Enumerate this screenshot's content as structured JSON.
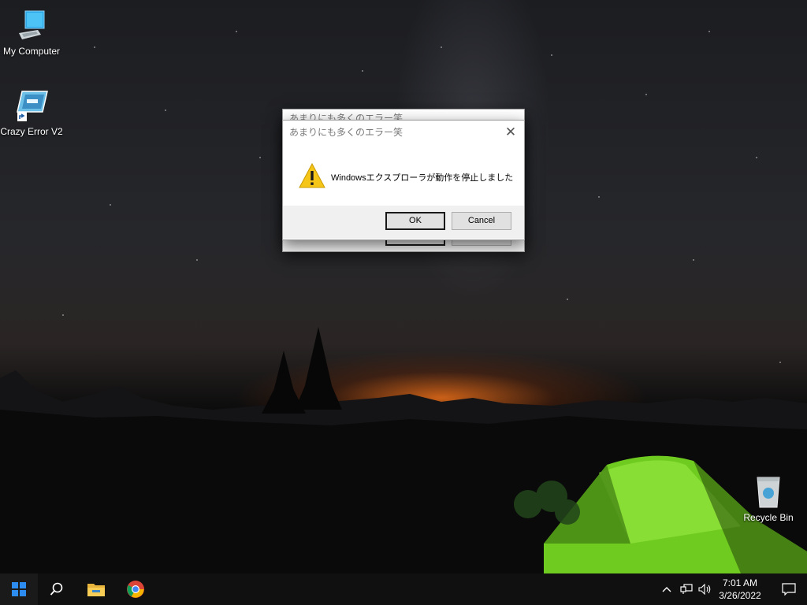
{
  "desktop": {
    "icons": [
      {
        "label": "My Computer",
        "icon": "computer-icon"
      },
      {
        "label": "Crazy Error V2",
        "icon": "app-shortcut-icon"
      },
      {
        "label": "Recycle Bin",
        "icon": "recycle-bin-icon"
      }
    ]
  },
  "dialog_back": {
    "title": "あまりにも多くのエラー笑"
  },
  "dialog": {
    "title": "あまりにも多くのエラー笑",
    "message": "Windowsエクスプローラが動作を停止しました",
    "icon": "warning-icon",
    "ok_label": "OK",
    "cancel_label": "Cancel"
  },
  "taskbar": {
    "items": [
      {
        "name": "start-button",
        "icon": "windows-logo-icon"
      },
      {
        "name": "search-button",
        "icon": "search-icon"
      },
      {
        "name": "file-explorer-button",
        "icon": "folder-icon"
      },
      {
        "name": "chrome-button",
        "icon": "chrome-icon"
      }
    ],
    "tray": {
      "time": "7:01 AM",
      "date": "3/26/2022"
    }
  },
  "colors": {
    "taskbar": "#101010",
    "tent_green": "#7ed321",
    "sunset_orange": "#e46a1a",
    "warning_yellow": "#f5c518"
  }
}
